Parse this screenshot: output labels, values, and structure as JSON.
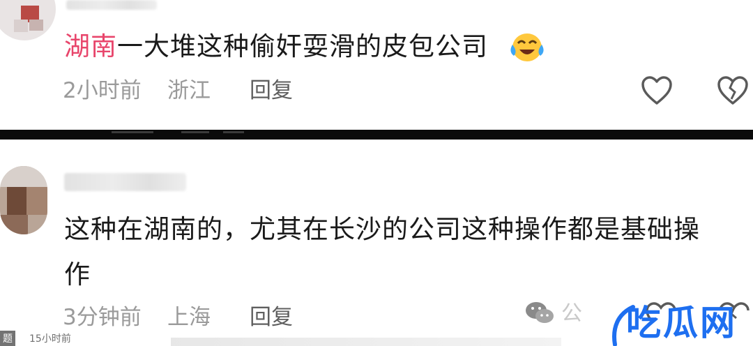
{
  "comments": [
    {
      "text_highlight": "湖南",
      "text_rest": "一大堆这种偷奸耍滑的皮包公司",
      "emoji": "laughing-crying-emoji",
      "time": "2小时前",
      "location": "浙江",
      "reply_label": "回复"
    },
    {
      "line1": "这种在湖南的，尤其在长沙的公司这种操作都是基础操",
      "line2": "作",
      "time": "3分钟前",
      "location": "上海",
      "reply_label": "回复"
    }
  ],
  "watermark": {
    "platform_text": "公",
    "brand": "吃瓜网",
    "corner_text": "15小时前",
    "corner_glyph": "题"
  },
  "colors": {
    "highlight": "#e8456b",
    "brand_blue": "#1e6ff0"
  }
}
